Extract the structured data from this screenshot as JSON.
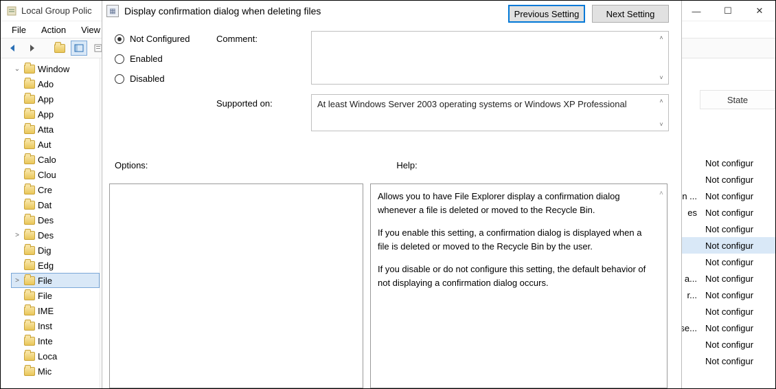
{
  "bg": {
    "title": "Local Group Polic",
    "menu": {
      "file": "File",
      "action": "Action",
      "view": "View"
    },
    "tree": {
      "root": "Window",
      "items": [
        "Ado",
        "App",
        "App",
        "Atta",
        "Aut",
        "Calo",
        "Clou",
        "Cre",
        "Dat",
        "Des",
        "Des",
        "Dig",
        "Edg",
        "File",
        "File",
        "IME",
        "Inst",
        "Inte",
        "Loca",
        "Mic"
      ],
      "expanders": {
        "10": ">",
        "13": ">"
      },
      "selected_index": 13
    }
  },
  "list": {
    "header_state": "State",
    "tails": [
      "",
      "",
      "n ...",
      "es",
      "",
      "",
      "",
      "a...",
      "r...",
      "",
      "se...",
      "",
      ""
    ],
    "states": [
      "Not configur",
      "Not configur",
      "Not configur",
      "Not configur",
      "Not configur",
      "Not configur",
      "Not configur",
      "Not configur",
      "Not configur",
      "Not configur",
      "Not configur",
      "Not configur",
      "Not configur"
    ],
    "selected_index": 5
  },
  "dialog": {
    "title": "Display confirmation dialog when deleting files",
    "prev": "Previous Setting",
    "next": "Next Setting",
    "radios": {
      "not_configured": "Not Configured",
      "enabled": "Enabled",
      "disabled": "Disabled",
      "selected": "not_configured"
    },
    "comment_label": "Comment:",
    "supported_label": "Supported on:",
    "supported_text": "At least Windows Server 2003 operating systems or Windows XP Professional",
    "options_label": "Options:",
    "help_label": "Help:",
    "help": {
      "p1": "Allows you to have File Explorer display a confirmation dialog whenever a file is deleted or moved to the Recycle Bin.",
      "p2": "If you enable this setting, a confirmation dialog is displayed when a file is deleted or moved to the Recycle Bin by the user.",
      "p3": "If you disable or do not configure this setting, the default behavior of not displaying a confirmation dialog occurs."
    }
  }
}
